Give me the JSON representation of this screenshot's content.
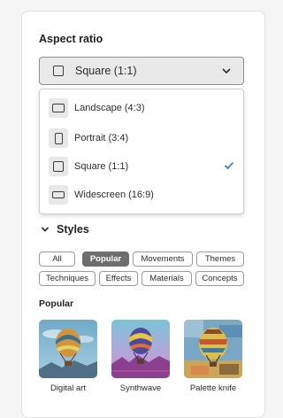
{
  "aspect_ratio": {
    "title": "Aspect ratio",
    "selected": {
      "label": "Square (1:1)",
      "icon": "square-icon"
    },
    "options": [
      {
        "label": "Landscape (4:3)",
        "icon": "landscape-icon",
        "selected": false
      },
      {
        "label": "Portrait (3:4)",
        "icon": "portrait-icon",
        "selected": false
      },
      {
        "label": "Square (1:1)",
        "icon": "square-icon",
        "selected": true
      },
      {
        "label": "Widescreen (16:9)",
        "icon": "widescreen-icon",
        "selected": false
      }
    ]
  },
  "styles": {
    "title": "Styles",
    "chips": [
      {
        "label": "All",
        "active": false
      },
      {
        "label": "Popular",
        "active": true
      },
      {
        "label": "Movements",
        "active": false
      },
      {
        "label": "Themes",
        "active": false
      },
      {
        "label": "Techniques",
        "active": false
      },
      {
        "label": "Effects",
        "active": false
      },
      {
        "label": "Materials",
        "active": false
      },
      {
        "label": "Concepts",
        "active": false
      }
    ]
  },
  "popular": {
    "title": "Popular",
    "items": [
      {
        "label": "Digital art"
      },
      {
        "label": "Synthwave"
      },
      {
        "label": "Palette knife"
      }
    ]
  },
  "colors": {
    "accent_check": "#1473e6",
    "active_chip": "#6e6e6e"
  }
}
